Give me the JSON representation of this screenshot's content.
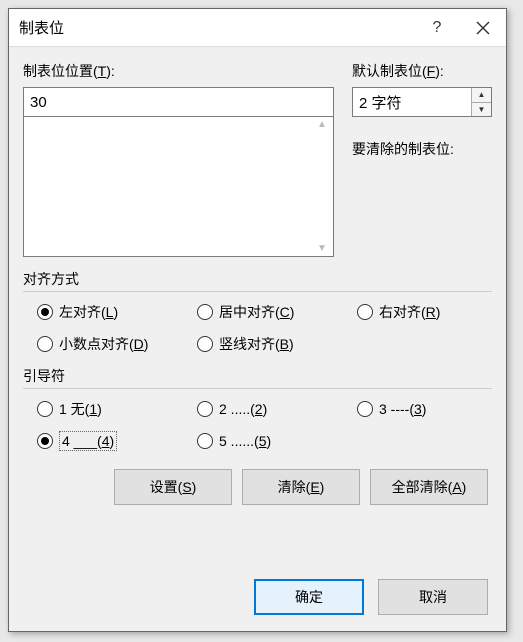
{
  "dialog": {
    "title": "制表位",
    "help_tooltip": "?",
    "close_tooltip": "关闭"
  },
  "position": {
    "label_prefix": "制表位位置(",
    "label_key": "T",
    "label_suffix": "):",
    "value": "30"
  },
  "default_tab": {
    "label_prefix": "默认制表位(",
    "label_key": "F",
    "label_suffix": "):",
    "value": "2 字符"
  },
  "clear_list_label": "要清除的制表位:",
  "align": {
    "title": "对齐方式",
    "options": {
      "left": {
        "text_prefix": "左对齐(",
        "key": "L",
        "suffix": ")"
      },
      "center": {
        "text_prefix": "居中对齐(",
        "key": "C",
        "suffix": ")"
      },
      "right": {
        "text_prefix": "右对齐(",
        "key": "R",
        "suffix": ")"
      },
      "decimal": {
        "text_prefix": "小数点对齐(",
        "key": "D",
        "suffix": ")"
      },
      "bar": {
        "text_prefix": "竖线对齐(",
        "key": "B",
        "suffix": ")"
      }
    },
    "selected": "left"
  },
  "leader": {
    "title": "引导符",
    "options": {
      "l1": {
        "text_prefix": "1 无(",
        "key": "1",
        "suffix": ")"
      },
      "l2": {
        "text_prefix": "2 .....(",
        "key": "2",
        "suffix": ")"
      },
      "l3": {
        "text_prefix": "3 ----(",
        "key": "3",
        "suffix": ")"
      },
      "l4": {
        "text_prefix": "4 ___(",
        "key": "4",
        "suffix": ")"
      },
      "l5": {
        "text_prefix": "5 ......(",
        "key": "5",
        "suffix": ")"
      }
    },
    "selected": "l4"
  },
  "buttons": {
    "set": {
      "text_prefix": "设置(",
      "key": "S",
      "suffix": ")"
    },
    "clear": {
      "text_prefix": "清除(",
      "key": "E",
      "suffix": ")"
    },
    "clearall": {
      "text_prefix": "全部清除(",
      "key": "A",
      "suffix": ")"
    },
    "ok": "确定",
    "cancel": "取消"
  }
}
